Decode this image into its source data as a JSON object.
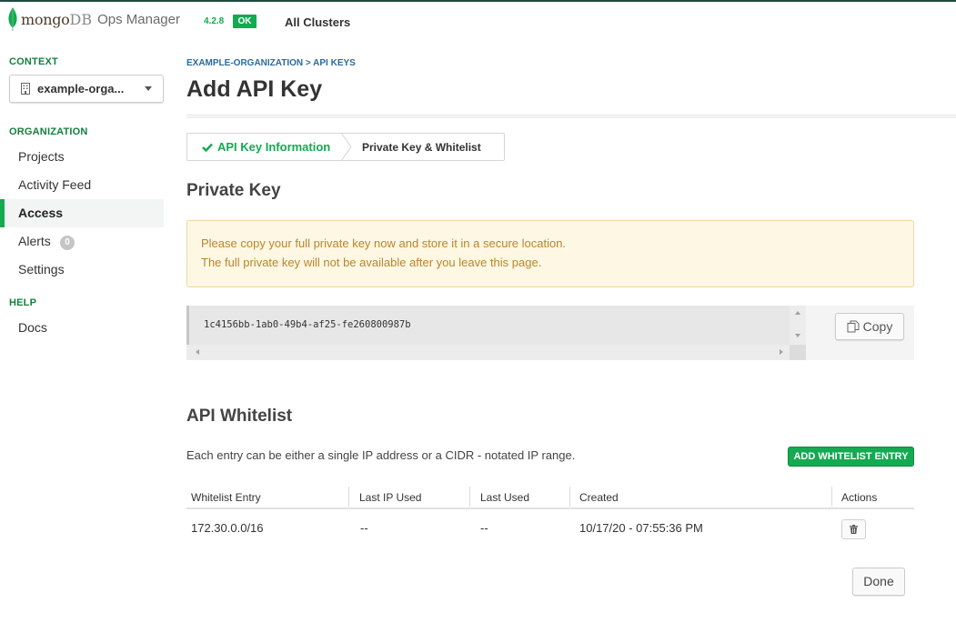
{
  "topbar": {
    "logo_mongo": "mongo",
    "logo_db": "DB",
    "logo_product": "Ops Manager",
    "version": "4.2.8",
    "status_badge": "OK",
    "all_clusters": "All Clusters",
    "brand_color": "#13aa52"
  },
  "sidebar": {
    "context_heading": "CONTEXT",
    "context_value": "example-orga...",
    "org_heading": "ORGANIZATION",
    "items": [
      {
        "label": "Projects"
      },
      {
        "label": "Activity Feed"
      },
      {
        "label": "Access",
        "active": true
      },
      {
        "label": "Alerts",
        "count": "0"
      },
      {
        "label": "Settings"
      }
    ],
    "help_heading": "HELP",
    "help_items": [
      {
        "label": "Docs"
      }
    ]
  },
  "main": {
    "breadcrumb": "EXAMPLE-ORGANIZATION > API KEYS",
    "title": "Add API Key",
    "steps": [
      {
        "label": "API Key Information",
        "completed": true
      },
      {
        "label": "Private Key & Whitelist",
        "completed": false
      }
    ],
    "private_key_heading": "Private Key",
    "warning_line1": "Please copy your full private key now and store it in a secure location.",
    "warning_line2": "The full private key will not be available after you leave this page.",
    "private_key_value": "1c4156bb-1ab0-49b4-af25-fe260800987b",
    "copy_label": "Copy",
    "whitelist_heading": "API Whitelist",
    "whitelist_description": "Each entry can be either a single IP address or a CIDR - notated IP range.",
    "add_entry_label": "ADD WHITELIST ENTRY",
    "table": {
      "headers": [
        "Whitelist Entry",
        "Last IP Used",
        "Last Used",
        "Created",
        "Actions"
      ],
      "rows": [
        {
          "entry": "172.30.0.0/16",
          "last_ip": "--",
          "last_used": "--",
          "created": "10/17/20 - 07:55:36 PM"
        }
      ]
    },
    "done_label": "Done"
  }
}
